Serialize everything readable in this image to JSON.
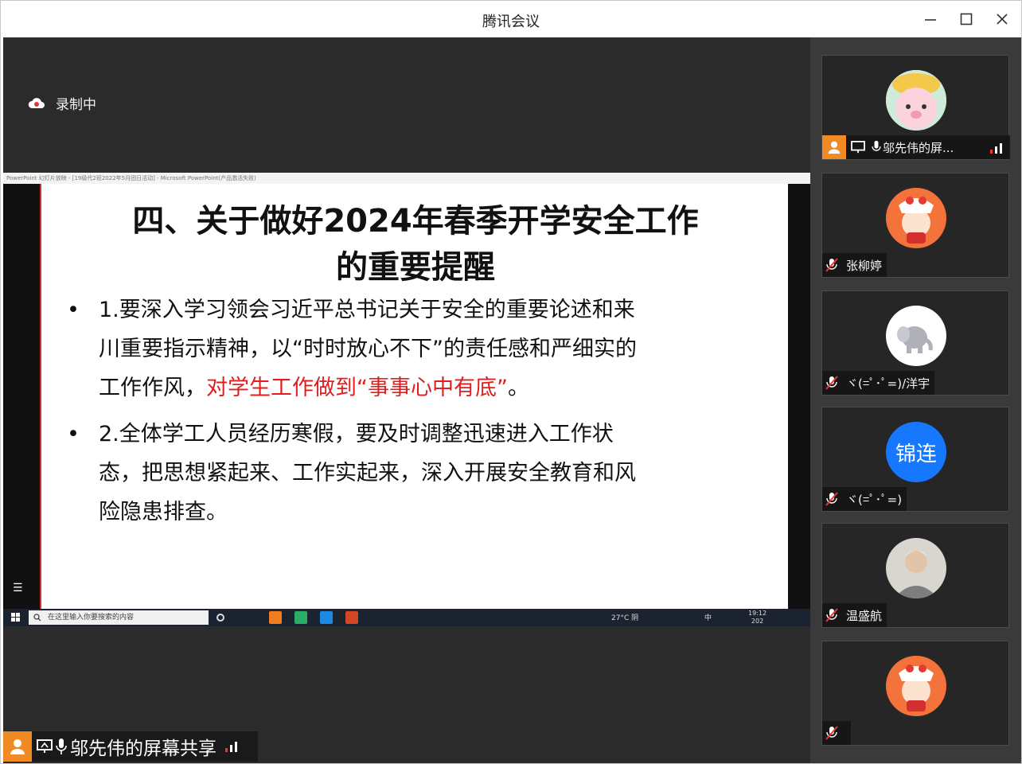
{
  "window": {
    "title": "腾讯会议"
  },
  "recording": {
    "label": "录制中"
  },
  "ppt": {
    "window_title": "PowerPoint 幻灯片放映 - [19级代2班2022年5月团日活动] - Microsoft PowerPoint(产品激活失败)"
  },
  "slide": {
    "title_line1": "四、关于做好2024年春季开学安全工作",
    "title_line2": "的重要提醒",
    "bullet1": {
      "dot": "•",
      "line1": "1.要深入学习领会习近平总书记关于安全的重要论述和来",
      "line2": "川重要指示精神，以“时时放心不下”的责任感和严细实的",
      "line3_black": "工作作风，",
      "line3_red": "对学生工作做到“事事心中有底”",
      "line3_end": "。"
    },
    "bullet2": {
      "dot": "•",
      "line1": "2.全体学工人员经历寒假，要及时调整迅速进入工作状",
      "line2": "态，把思想紧起来、工作实起来，深入开展安全教育和风",
      "line3": "险隐患排查。"
    }
  },
  "taskbar": {
    "search_placeholder": "在这里输入你要搜索的内容",
    "weather": "27°C 阴",
    "ime": "中",
    "time": "19:12",
    "date": "202"
  },
  "sharer": {
    "name": "邬先伟的屏幕共享"
  },
  "participants": [
    {
      "name": "邬先伟的屏...",
      "avatar": "cartoon-pig"
    },
    {
      "name": "张柳婷",
      "avatar": "lion-doll"
    },
    {
      "name": "ヾ(=ﾟ･ﾟ=)/洋宇",
      "avatar": "elephant"
    },
    {
      "name": "ヾ(=ﾟ･ﾟ=)",
      "avatar_text": "锦连"
    },
    {
      "name": "温盛航",
      "avatar": "photo"
    },
    {
      "name": "",
      "avatar": "lion-doll"
    }
  ],
  "colors": {
    "accent_orange": "#f08a24",
    "signal_red": "#e53935",
    "slide_red": "#e02020",
    "avatar_blue": "#1677ff"
  }
}
